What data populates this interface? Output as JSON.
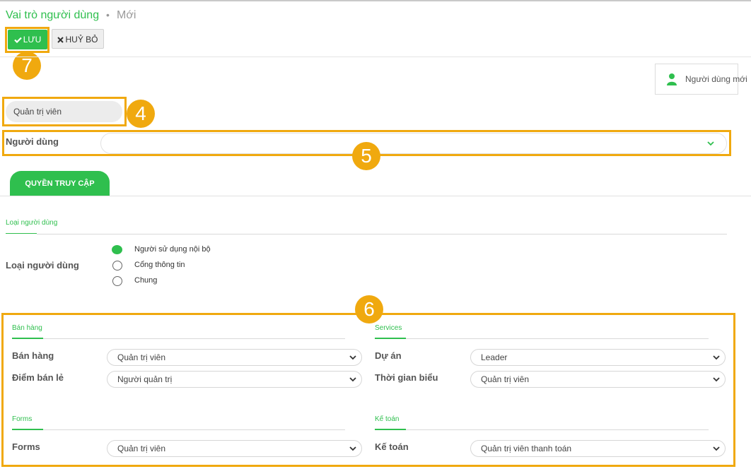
{
  "breadcrumb": {
    "title": "Vai trò người dùng",
    "separator": "•",
    "current": "Mới"
  },
  "toolbar": {
    "save_label": "LƯU",
    "cancel_label": "HUỶ BỎ"
  },
  "annotations": {
    "badge_7": "7",
    "badge_4": "4",
    "badge_5": "5",
    "badge_6": "6"
  },
  "smart_button": {
    "label": "Người dùng mới",
    "icon": "user-icon"
  },
  "role": {
    "name": "Quản trị viên"
  },
  "users_field": {
    "label": "Người dùng",
    "value": ""
  },
  "tabs": [
    {
      "label": "QUYỀN TRUY CẬP",
      "active": true
    }
  ],
  "user_type": {
    "section_title": "Loại người dùng",
    "field_label": "Loại người dùng",
    "options": [
      {
        "label": "Người sử dụng nội bộ",
        "selected": true
      },
      {
        "label": "Cổng thông tin",
        "selected": false
      },
      {
        "label": "Chung",
        "selected": false
      }
    ]
  },
  "groups": {
    "sales": {
      "title": "Bán hàng",
      "rows": [
        {
          "label": "Bán hàng",
          "value": "Quản trị viên"
        },
        {
          "label": "Điểm bán lẻ",
          "value": "Người quản trị"
        }
      ]
    },
    "services": {
      "title": "Services",
      "rows": [
        {
          "label": "Dự án",
          "value": "Leader"
        },
        {
          "label": "Thời gian biểu",
          "value": "Quản trị viên"
        }
      ]
    },
    "forms": {
      "title": "Forms",
      "rows": [
        {
          "label": "Forms",
          "value": "Quản trị viên"
        }
      ]
    },
    "accounting": {
      "title": "Kế toán",
      "rows": [
        {
          "label": "Kế toán",
          "value": "Quản trị viên thanh toán"
        }
      ]
    }
  },
  "colors": {
    "accent": "#2fbf4e",
    "highlight": "#f0a90f"
  }
}
